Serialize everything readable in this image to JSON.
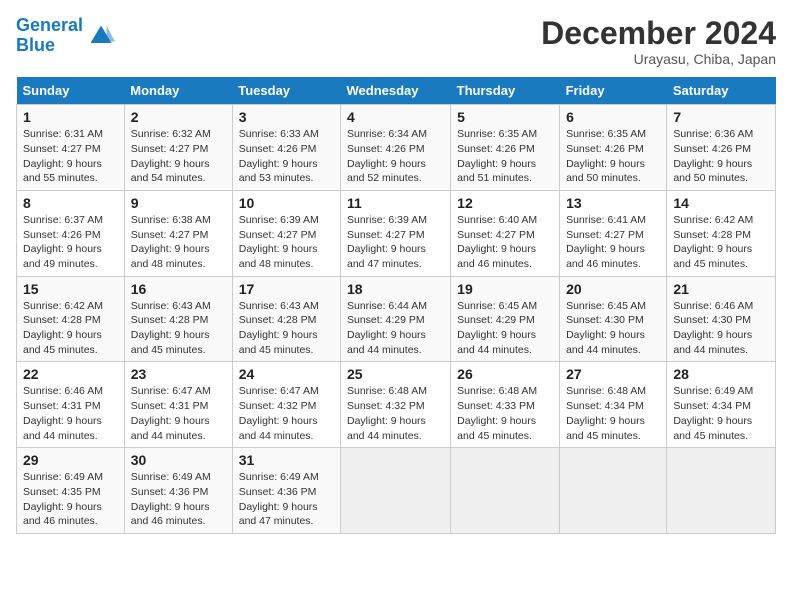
{
  "header": {
    "logo_line1": "General",
    "logo_line2": "Blue",
    "month_title": "December 2024",
    "location": "Urayasu, Chiba, Japan"
  },
  "weekdays": [
    "Sunday",
    "Monday",
    "Tuesday",
    "Wednesday",
    "Thursday",
    "Friday",
    "Saturday"
  ],
  "weeks": [
    [
      {
        "day": "1",
        "info": "Sunrise: 6:31 AM\nSunset: 4:27 PM\nDaylight: 9 hours\nand 55 minutes."
      },
      {
        "day": "2",
        "info": "Sunrise: 6:32 AM\nSunset: 4:27 PM\nDaylight: 9 hours\nand 54 minutes."
      },
      {
        "day": "3",
        "info": "Sunrise: 6:33 AM\nSunset: 4:26 PM\nDaylight: 9 hours\nand 53 minutes."
      },
      {
        "day": "4",
        "info": "Sunrise: 6:34 AM\nSunset: 4:26 PM\nDaylight: 9 hours\nand 52 minutes."
      },
      {
        "day": "5",
        "info": "Sunrise: 6:35 AM\nSunset: 4:26 PM\nDaylight: 9 hours\nand 51 minutes."
      },
      {
        "day": "6",
        "info": "Sunrise: 6:35 AM\nSunset: 4:26 PM\nDaylight: 9 hours\nand 50 minutes."
      },
      {
        "day": "7",
        "info": "Sunrise: 6:36 AM\nSunset: 4:26 PM\nDaylight: 9 hours\nand 50 minutes."
      }
    ],
    [
      {
        "day": "8",
        "info": "Sunrise: 6:37 AM\nSunset: 4:26 PM\nDaylight: 9 hours\nand 49 minutes."
      },
      {
        "day": "9",
        "info": "Sunrise: 6:38 AM\nSunset: 4:27 PM\nDaylight: 9 hours\nand 48 minutes."
      },
      {
        "day": "10",
        "info": "Sunrise: 6:39 AM\nSunset: 4:27 PM\nDaylight: 9 hours\nand 48 minutes."
      },
      {
        "day": "11",
        "info": "Sunrise: 6:39 AM\nSunset: 4:27 PM\nDaylight: 9 hours\nand 47 minutes."
      },
      {
        "day": "12",
        "info": "Sunrise: 6:40 AM\nSunset: 4:27 PM\nDaylight: 9 hours\nand 46 minutes."
      },
      {
        "day": "13",
        "info": "Sunrise: 6:41 AM\nSunset: 4:27 PM\nDaylight: 9 hours\nand 46 minutes."
      },
      {
        "day": "14",
        "info": "Sunrise: 6:42 AM\nSunset: 4:28 PM\nDaylight: 9 hours\nand 45 minutes."
      }
    ],
    [
      {
        "day": "15",
        "info": "Sunrise: 6:42 AM\nSunset: 4:28 PM\nDaylight: 9 hours\nand 45 minutes."
      },
      {
        "day": "16",
        "info": "Sunrise: 6:43 AM\nSunset: 4:28 PM\nDaylight: 9 hours\nand 45 minutes."
      },
      {
        "day": "17",
        "info": "Sunrise: 6:43 AM\nSunset: 4:28 PM\nDaylight: 9 hours\nand 45 minutes."
      },
      {
        "day": "18",
        "info": "Sunrise: 6:44 AM\nSunset: 4:29 PM\nDaylight: 9 hours\nand 44 minutes."
      },
      {
        "day": "19",
        "info": "Sunrise: 6:45 AM\nSunset: 4:29 PM\nDaylight: 9 hours\nand 44 minutes."
      },
      {
        "day": "20",
        "info": "Sunrise: 6:45 AM\nSunset: 4:30 PM\nDaylight: 9 hours\nand 44 minutes."
      },
      {
        "day": "21",
        "info": "Sunrise: 6:46 AM\nSunset: 4:30 PM\nDaylight: 9 hours\nand 44 minutes."
      }
    ],
    [
      {
        "day": "22",
        "info": "Sunrise: 6:46 AM\nSunset: 4:31 PM\nDaylight: 9 hours\nand 44 minutes."
      },
      {
        "day": "23",
        "info": "Sunrise: 6:47 AM\nSunset: 4:31 PM\nDaylight: 9 hours\nand 44 minutes."
      },
      {
        "day": "24",
        "info": "Sunrise: 6:47 AM\nSunset: 4:32 PM\nDaylight: 9 hours\nand 44 minutes."
      },
      {
        "day": "25",
        "info": "Sunrise: 6:48 AM\nSunset: 4:32 PM\nDaylight: 9 hours\nand 44 minutes."
      },
      {
        "day": "26",
        "info": "Sunrise: 6:48 AM\nSunset: 4:33 PM\nDaylight: 9 hours\nand 45 minutes."
      },
      {
        "day": "27",
        "info": "Sunrise: 6:48 AM\nSunset: 4:34 PM\nDaylight: 9 hours\nand 45 minutes."
      },
      {
        "day": "28",
        "info": "Sunrise: 6:49 AM\nSunset: 4:34 PM\nDaylight: 9 hours\nand 45 minutes."
      }
    ],
    [
      {
        "day": "29",
        "info": "Sunrise: 6:49 AM\nSunset: 4:35 PM\nDaylight: 9 hours\nand 46 minutes."
      },
      {
        "day": "30",
        "info": "Sunrise: 6:49 AM\nSunset: 4:36 PM\nDaylight: 9 hours\nand 46 minutes."
      },
      {
        "day": "31",
        "info": "Sunrise: 6:49 AM\nSunset: 4:36 PM\nDaylight: 9 hours\nand 47 minutes."
      },
      null,
      null,
      null,
      null
    ]
  ]
}
